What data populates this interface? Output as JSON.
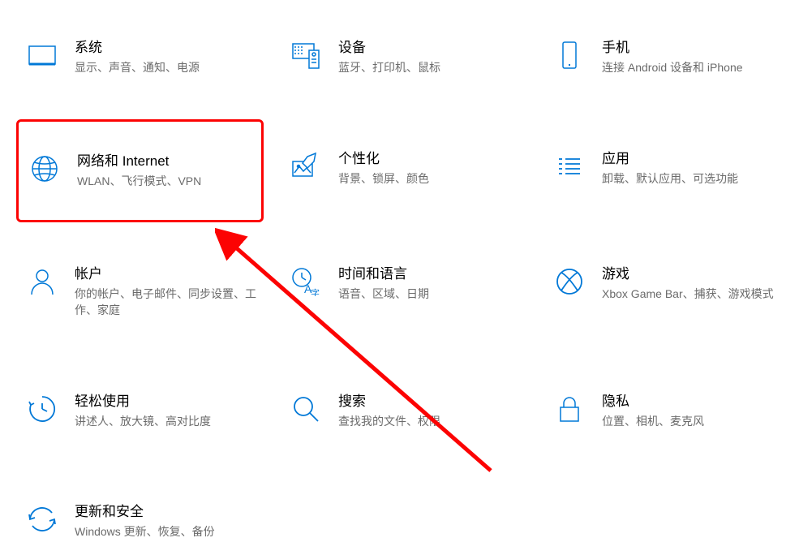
{
  "annotation": {
    "highlight_color": "#fc0303",
    "arrow_color": "#fc0303"
  },
  "items": [
    {
      "id": "system",
      "title": "系统",
      "subtitle": "显示、声音、通知、电源"
    },
    {
      "id": "devices",
      "title": "设备",
      "subtitle": "蓝牙、打印机、鼠标"
    },
    {
      "id": "phone",
      "title": "手机",
      "subtitle": "连接 Android 设备和 iPhone"
    },
    {
      "id": "network",
      "title": "网络和 Internet",
      "subtitle": "WLAN、飞行模式、VPN",
      "highlighted": true
    },
    {
      "id": "personalization",
      "title": "个性化",
      "subtitle": "背景、锁屏、颜色"
    },
    {
      "id": "apps",
      "title": "应用",
      "subtitle": "卸载、默认应用、可选功能"
    },
    {
      "id": "accounts",
      "title": "帐户",
      "subtitle": "你的帐户、电子邮件、同步设置、工作、家庭"
    },
    {
      "id": "time-language",
      "title": "时间和语言",
      "subtitle": "语音、区域、日期"
    },
    {
      "id": "gaming",
      "title": "游戏",
      "subtitle": "Xbox Game Bar、捕获、游戏模式"
    },
    {
      "id": "ease-of-access",
      "title": "轻松使用",
      "subtitle": "讲述人、放大镜、高对比度"
    },
    {
      "id": "search",
      "title": "搜索",
      "subtitle": "查找我的文件、权限"
    },
    {
      "id": "privacy",
      "title": "隐私",
      "subtitle": "位置、相机、麦克风"
    },
    {
      "id": "update-security",
      "title": "更新和安全",
      "subtitle": "Windows 更新、恢复、备份"
    }
  ]
}
